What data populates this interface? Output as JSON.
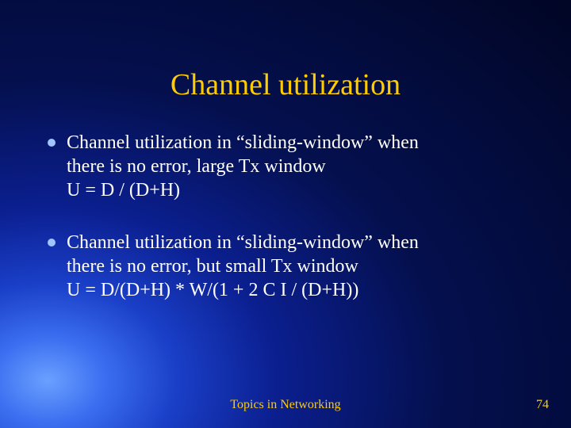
{
  "title": "Channel utilization",
  "bullets": [
    {
      "line1": "Channel utilization in “sliding-window” when",
      "line2": "there is no error, large Tx window",
      "line3": "U = D / (D+H)"
    },
    {
      "line1": "Channel utilization in “sliding-window” when",
      "line2": "there is no error, but small Tx window",
      "line3": "U = D/(D+H) * W/(1 + 2 C I / (D+H))"
    }
  ],
  "footer": {
    "center": "Topics in Networking",
    "pageNumber": "74"
  }
}
